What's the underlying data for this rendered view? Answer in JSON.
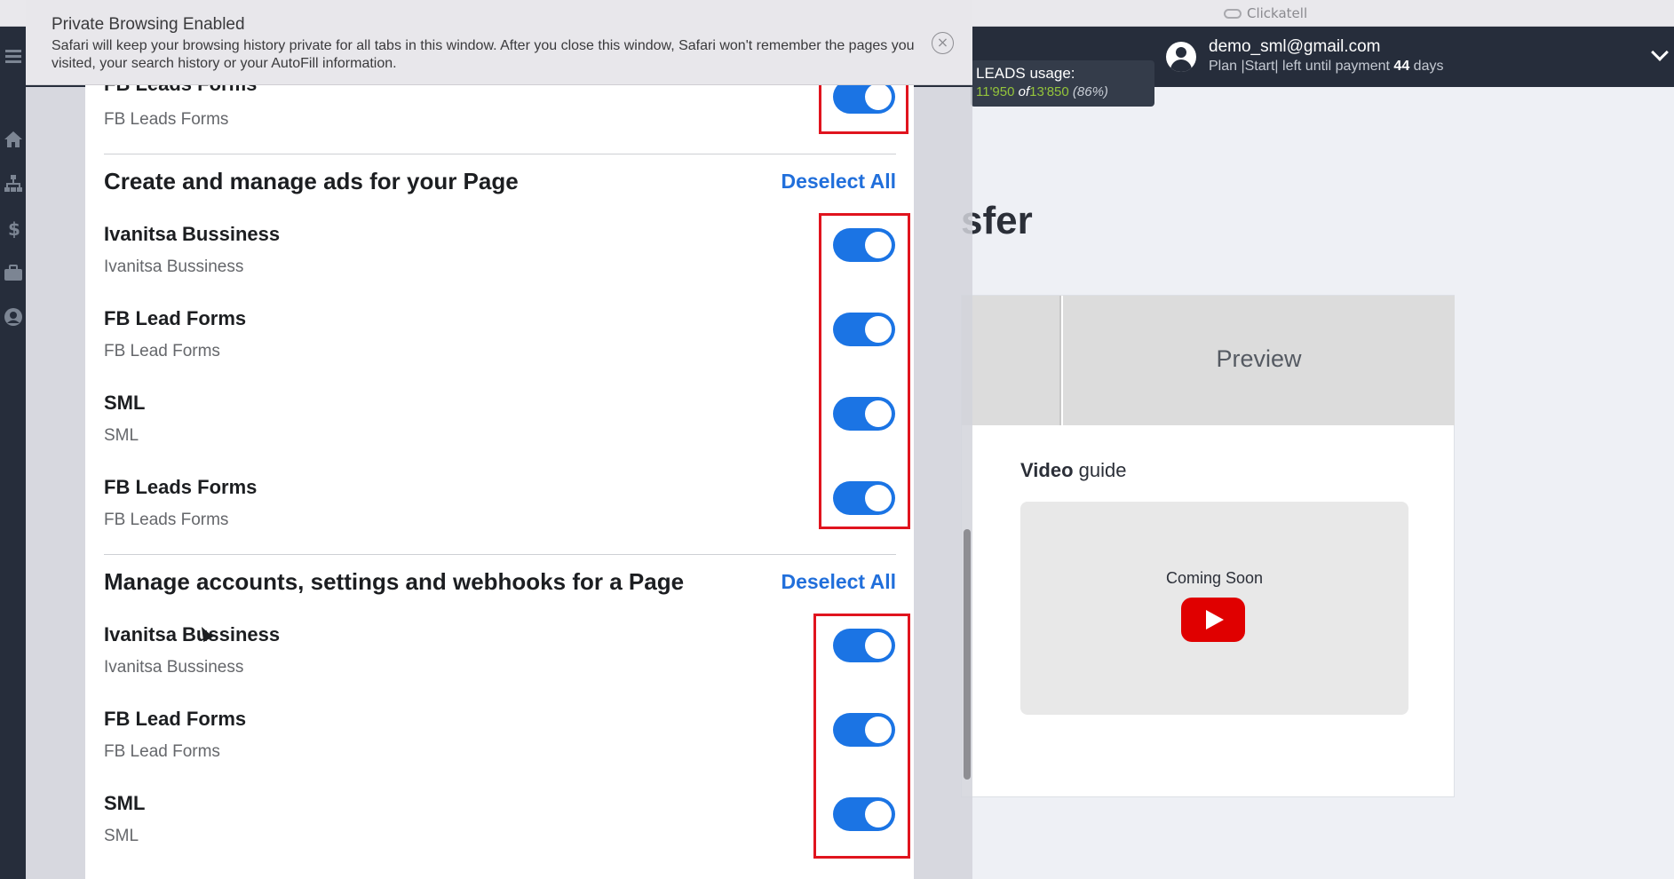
{
  "window": {
    "title": "Clickatell"
  },
  "private_banner": {
    "title": "Private Browsing Enabled",
    "message": "Safari will keep your browsing history private for all tabs in this window. After you close this window, Safari won't remember the pages you visited, your search history or your AutoFill information.",
    "close_icon": "×"
  },
  "header": {
    "leads_label": "LEADS usage:",
    "leads_used": "11'950",
    "leads_of": "of",
    "leads_total": "13'850",
    "leads_percent": "(86%)",
    "user_email": "demo_sml@gmail.com",
    "plan_prefix": "Plan |Start| left until payment",
    "plan_days": "44",
    "plan_suffix": "days"
  },
  "background_page": {
    "title_fragment": "sfer",
    "tab_preview": "Preview",
    "video_label_bold": "Video",
    "video_label_rest": " guide",
    "coming_soon": "Coming Soon"
  },
  "dialog": {
    "top_item": {
      "title": "FB Leads Forms",
      "subtitle": "FB Leads Forms",
      "enabled": true
    },
    "sections": [
      {
        "title": "Create and manage ads for your Page",
        "deselect": "Deselect All",
        "items": [
          {
            "title": "Ivanitsa Bussiness",
            "subtitle": "Ivanitsa Bussiness",
            "enabled": true
          },
          {
            "title": "FB Lead Forms",
            "subtitle": "FB Lead Forms",
            "enabled": true
          },
          {
            "title": "SML",
            "subtitle": "SML",
            "enabled": true
          },
          {
            "title": "FB Leads Forms",
            "subtitle": "FB Leads Forms",
            "enabled": true
          }
        ]
      },
      {
        "title": "Manage accounts, settings and webhooks for a Page",
        "deselect": "Deselect All",
        "items": [
          {
            "title": "Ivanitsa Bussiness",
            "subtitle": "Ivanitsa Bussiness",
            "enabled": true
          },
          {
            "title": "FB Lead Forms",
            "subtitle": "FB Lead Forms",
            "enabled": true
          },
          {
            "title": "SML",
            "subtitle": "SML",
            "enabled": true
          }
        ]
      }
    ]
  },
  "colors": {
    "toggle_on": "#1b74e4",
    "link": "#216fdb",
    "highlight": "#e0141e",
    "header_bg": "#262d3b",
    "leads_green": "#94c43b"
  }
}
